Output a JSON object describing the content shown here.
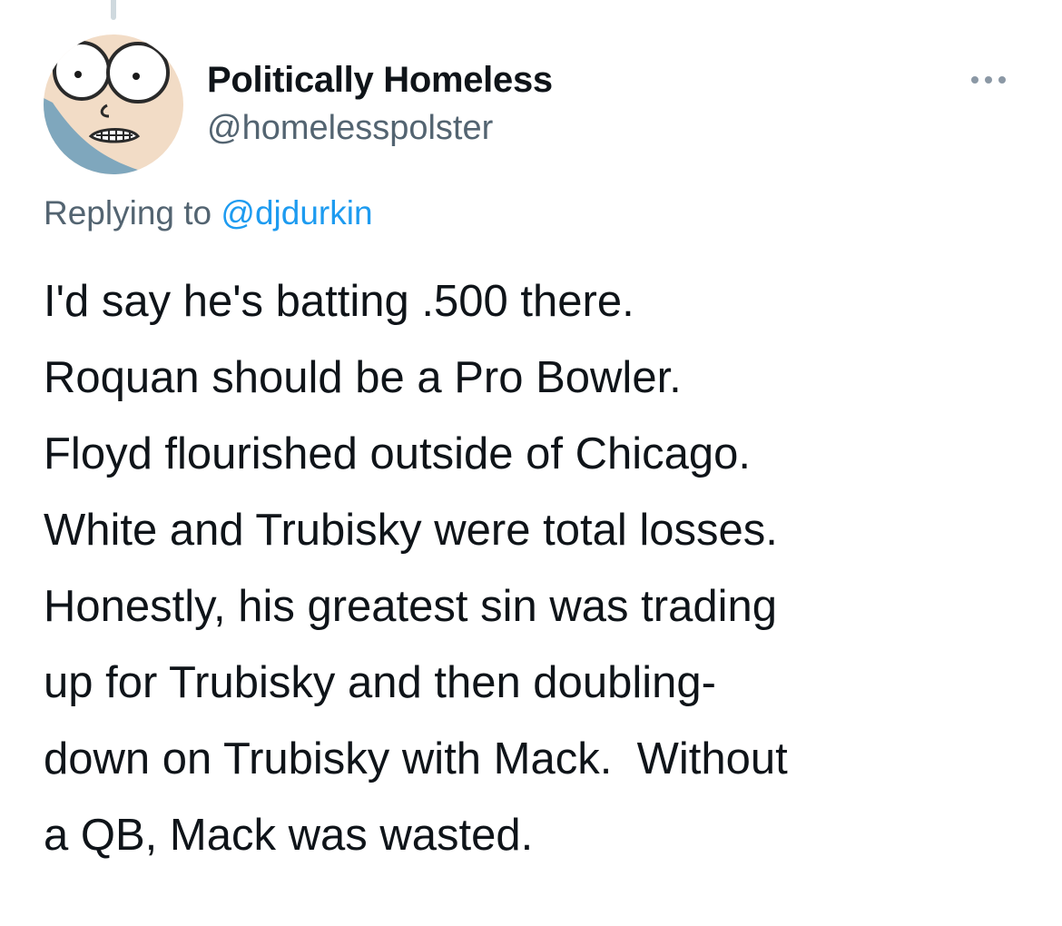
{
  "tweet": {
    "author": {
      "display_name": "Politically Homeless",
      "handle": "@homelesspolster",
      "avatar_icon": "cartoon-avatar"
    },
    "more_icon": "more-options-icon",
    "reply_prefix": "Replying to ",
    "reply_to": "@djdurkin",
    "text_lines": [
      "I'd say he's batting .500 there.",
      "Roquan should be a Pro Bowler.",
      "Floyd flourished outside of Chicago.",
      "White and Trubisky were total losses.",
      "Honestly, his greatest sin was trading",
      "up for Trubisky and then doubling-",
      "down on Trubisky with Mack.  Without",
      "a QB, Mack was wasted."
    ],
    "colors": {
      "accent": "#1d9bf0",
      "text": "#0f1419",
      "secondary": "#536471"
    }
  }
}
